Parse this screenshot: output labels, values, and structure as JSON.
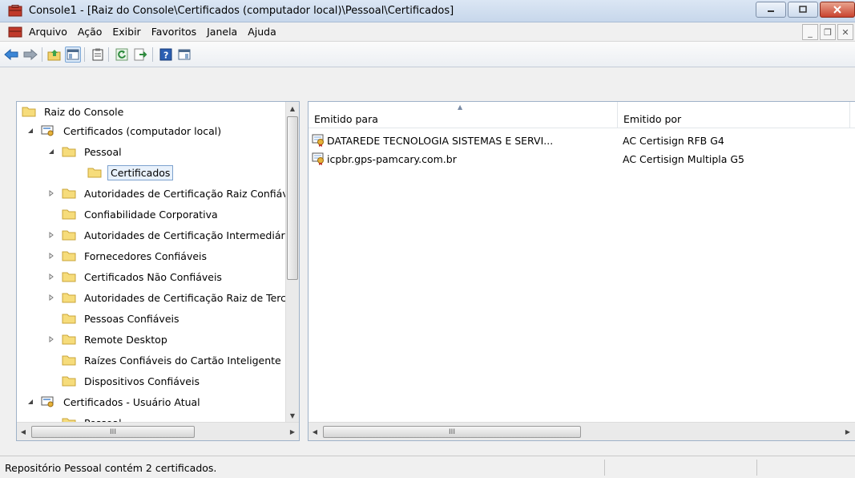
{
  "window": {
    "title": "Console1 - [Raiz do Console\\Certificados (computador local)\\Pessoal\\Certificados]",
    "icon": "mmc-toolbox-icon"
  },
  "menu": {
    "items": [
      "Arquivo",
      "Ação",
      "Exibir",
      "Favoritos",
      "Janela",
      "Ajuda"
    ]
  },
  "toolbar": {
    "icons": [
      "back-arrow-icon",
      "forward-arrow-icon",
      "up-folder-icon",
      "show-hide-tree-icon",
      "clipboard-icon",
      "refresh-icon",
      "export-list-icon",
      "help-icon",
      "show-action-pane-icon"
    ]
  },
  "tree": {
    "items": [
      {
        "label": "Raiz do Console"
      },
      {
        "label": "Certificados (computador local)"
      },
      {
        "label": "Pessoal"
      },
      {
        "label": "Certificados"
      },
      {
        "label": "Autoridades de Certificação Raiz Confiáveis"
      },
      {
        "label": "Confiabilidade Corporativa"
      },
      {
        "label": "Autoridades de Certificação Intermediárias"
      },
      {
        "label": "Fornecedores Confiáveis"
      },
      {
        "label": "Certificados Não Confiáveis"
      },
      {
        "label": "Autoridades de Certificação Raiz de Terceiros"
      },
      {
        "label": "Pessoas Confiáveis"
      },
      {
        "label": "Remote Desktop"
      },
      {
        "label": "Raízes Confiáveis do Cartão Inteligente"
      },
      {
        "label": "Dispositivos Confiáveis"
      },
      {
        "label": "Certificados - Usuário Atual"
      },
      {
        "label": "Pessoal"
      }
    ]
  },
  "list": {
    "columns": [
      "Emitido para",
      "Emitido por"
    ],
    "rows": [
      {
        "issued_to": "DATAREDE TECNOLOGIA SISTEMAS E SERVI...",
        "issued_by": "AC Certisign RFB G4"
      },
      {
        "issued_to": "icpbr.gps-pamcary.com.br",
        "issued_by": "AC Certisign Multipla G5"
      }
    ]
  },
  "scrollbar": {
    "hthumb_label": "III"
  },
  "status": {
    "text": "Repositório Pessoal contém 2 certificados."
  }
}
